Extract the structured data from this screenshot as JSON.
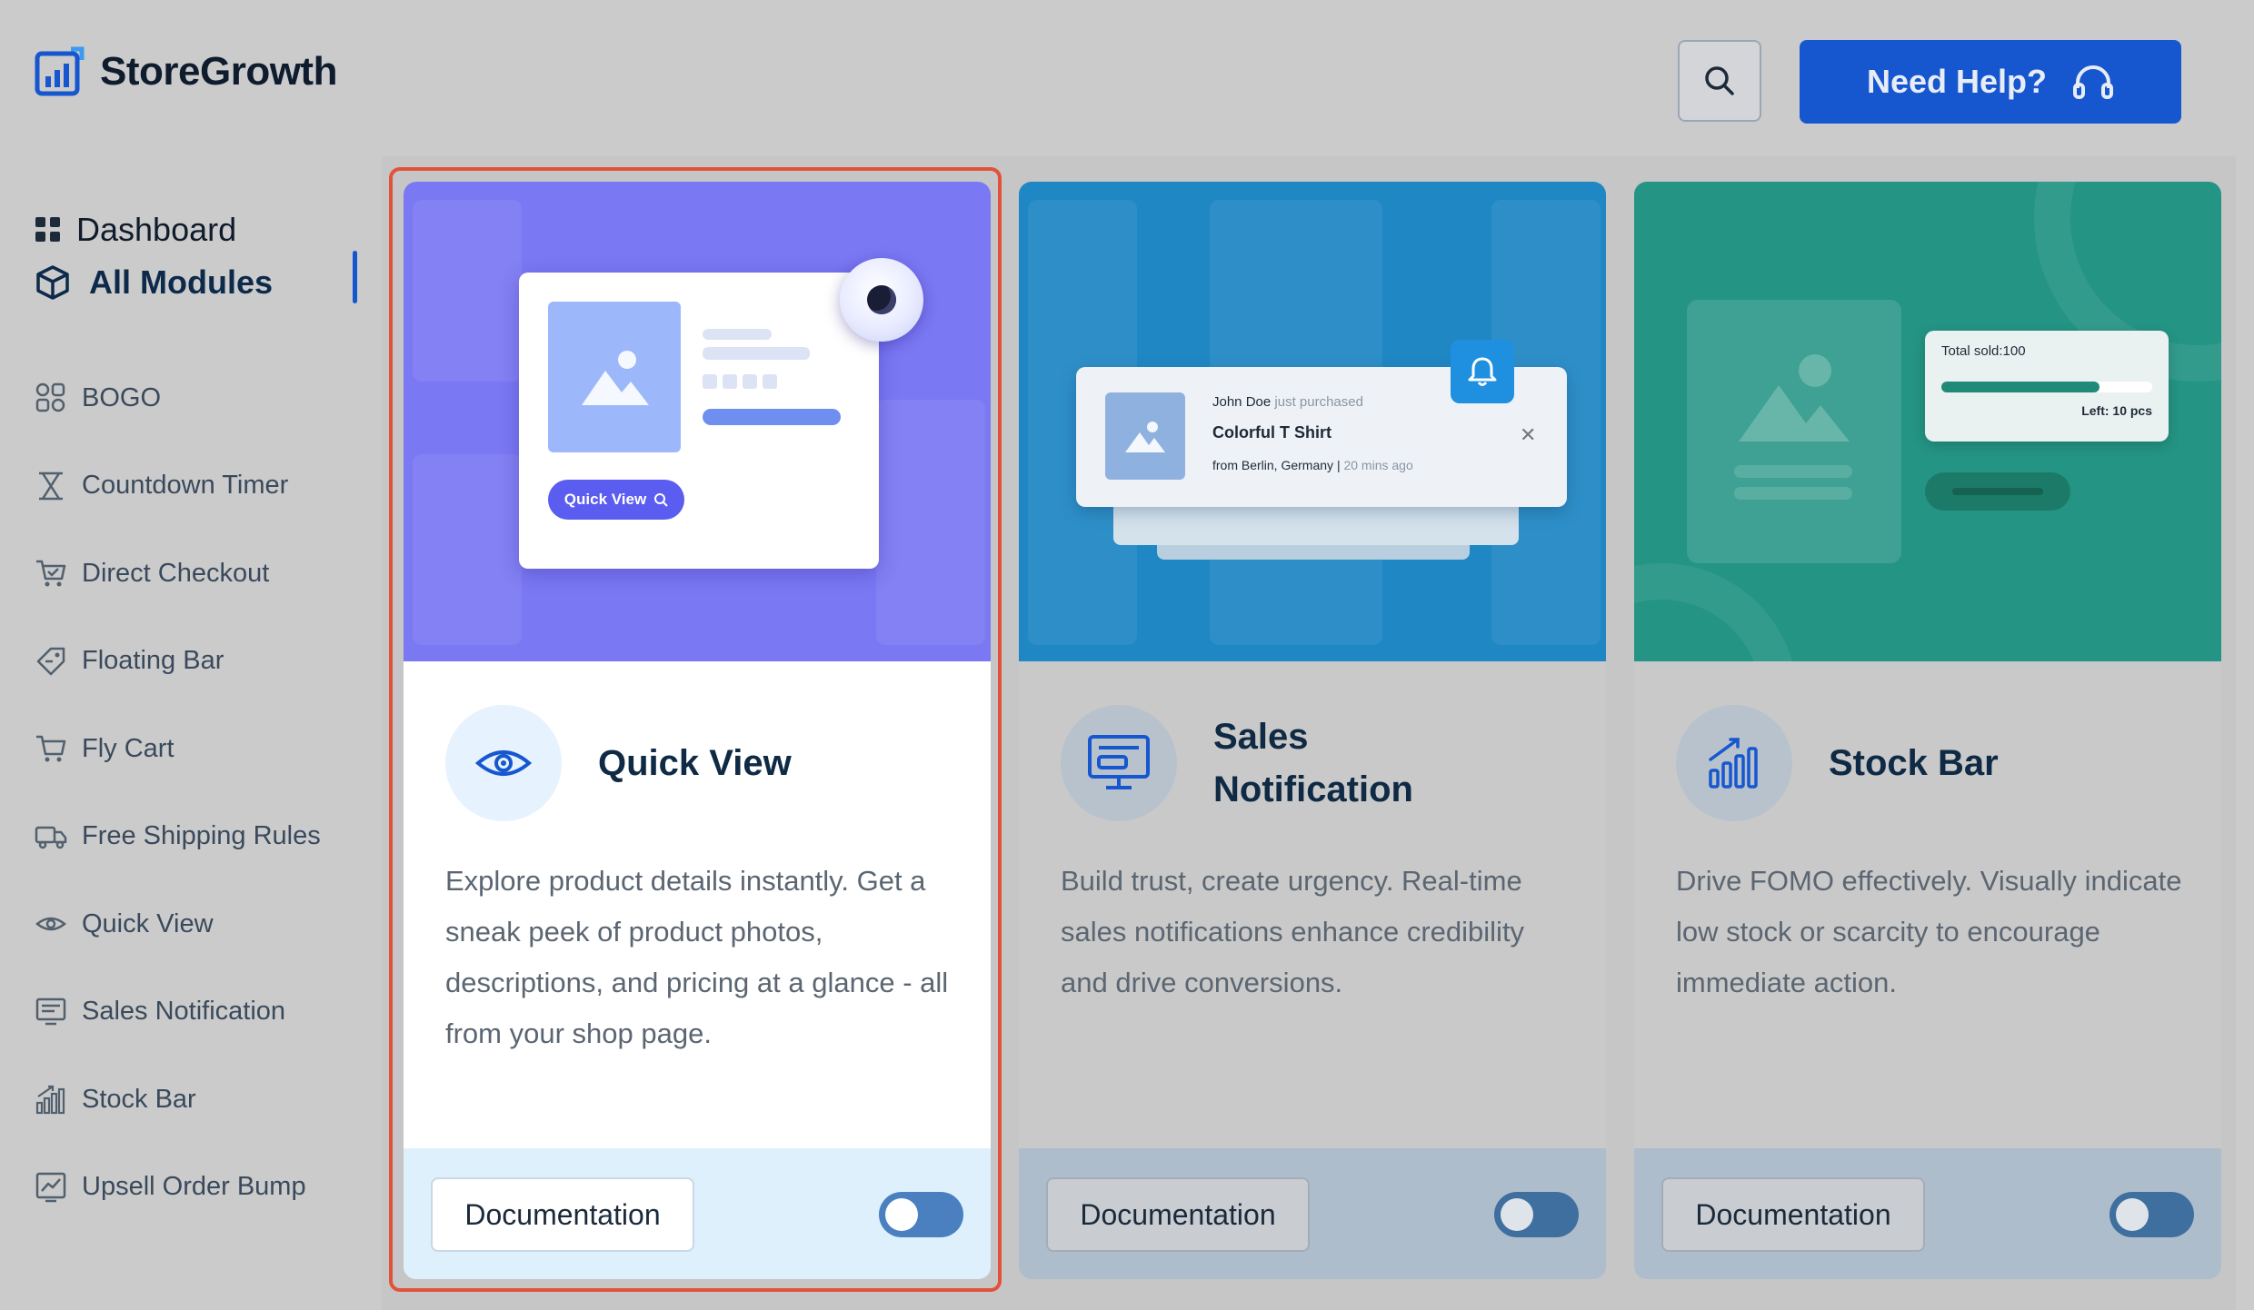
{
  "app": {
    "name": "StoreGrowth"
  },
  "header": {
    "help_label": "Need Help?",
    "search_icon": "search-icon",
    "help_icon": "headset-icon"
  },
  "sidebar": {
    "top": [
      {
        "label": "Dashboard",
        "icon": "grid-icon"
      },
      {
        "label": "All Modules",
        "icon": "cube-icon",
        "active": true
      }
    ],
    "modules": [
      {
        "label": "BOGO",
        "icon": "bogo-icon"
      },
      {
        "label": "Countdown Timer",
        "icon": "hourglass-icon"
      },
      {
        "label": "Direct Checkout",
        "icon": "cart-check-icon"
      },
      {
        "label": "Floating Bar",
        "icon": "tag-icon"
      },
      {
        "label": "Fly Cart",
        "icon": "cart-icon"
      },
      {
        "label": "Free Shipping Rules",
        "icon": "truck-icon"
      },
      {
        "label": "Quick View",
        "icon": "eye-icon"
      },
      {
        "label": "Sales Notification",
        "icon": "monitor-icon"
      },
      {
        "label": "Stock Bar",
        "icon": "chart-bars-icon"
      },
      {
        "label": "Upsell Order Bump",
        "icon": "trend-chart-icon"
      }
    ]
  },
  "cards": [
    {
      "title": "Quick View",
      "description": "Explore product details instantly. Get a sneak peek of product photos, descriptions, and pricing at a glance - all from your shop page.",
      "doc_label": "Documentation",
      "enabled": false,
      "icon": "eye-icon",
      "hero": {
        "pill_label": "Quick View"
      }
    },
    {
      "title": "Sales Notification",
      "description": "Build trust, create urgency. Real-time sales notifications enhance credibility and drive conversions.",
      "doc_label": "Documentation",
      "enabled": false,
      "icon": "monitor-icon",
      "hero": {
        "buyer": "John Doe",
        "action": "just purchased",
        "product": "Colorful T Shirt",
        "location": "from Berlin, Germany",
        "separator": "|",
        "time": "20 mins ago"
      }
    },
    {
      "title": "Stock Bar",
      "description": "Drive FOMO effectively. Visually indicate low stock or scarcity to encourage immediate action.",
      "doc_label": "Documentation",
      "enabled": false,
      "icon": "chart-bars-icon",
      "hero": {
        "total_label": "Total sold:100",
        "left_label": "Left: 10 pcs",
        "sold_fraction": 0.75
      }
    }
  ],
  "colors": {
    "accent": "#1657cf",
    "highlight_border": "#e2523a",
    "quick_view_hero": "#7b78f4",
    "sales_hero": "#1f87c4",
    "stock_hero": "#249484"
  }
}
